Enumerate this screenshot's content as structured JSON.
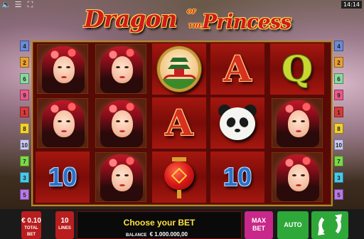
{
  "top_bar": {
    "icons": [
      "sound-icon",
      "menu-icon",
      "fullscreen-icon"
    ],
    "clock": "14:14"
  },
  "logo": {
    "main_part1": "Dragon",
    "small_of": "OF",
    "small_the": "THE",
    "main_part2": "Princess"
  },
  "reels": {
    "columns": [
      [
        "princess",
        "princess",
        "princess"
      ],
      [
        "princess",
        "princess",
        "princess"
      ],
      [
        "pagoda",
        "A",
        "lantern"
      ],
      [
        "A",
        "panda",
        "10"
      ],
      [
        "Q",
        "princess",
        "princess"
      ]
    ],
    "top_left_princess_symbols": [
      "princess",
      "princess"
    ],
    "bottom_left_symbol": "10",
    "bottom_second_symbol": "princess"
  },
  "symbols": {
    "A": "A",
    "Q": "Q",
    "ten": "10"
  },
  "line_numbers": {
    "left": [
      "4",
      "2",
      "6",
      "9",
      "1",
      "8",
      "10",
      "7",
      "3",
      "5"
    ],
    "right": [
      "4",
      "2",
      "6",
      "9",
      "1",
      "8",
      "10",
      "7",
      "3",
      "5"
    ]
  },
  "line_colors": [
    "#6a8ad8",
    "#e8a030",
    "#8ad8a0",
    "#e85a8a",
    "#d83a3a",
    "#f0d030",
    "#c8c8f0",
    "#7ad848",
    "#48c8e8",
    "#b878e8"
  ],
  "bottom": {
    "total_bet_value": "€ 0.10",
    "total_bet_label": "TOTAL BET",
    "lines_value": "10",
    "lines_label": "LINES",
    "message": "Choose your BET",
    "balance_label": "BALANCE",
    "balance_value": "€ 1.000.000,00",
    "max_bet_line1": "MAX",
    "max_bet_line2": "BET",
    "auto_label": "AUTO"
  },
  "colors": {
    "bet_button": "#b81e1e",
    "max_bet_button": "#c8288a",
    "auto_button": "#2fa83a",
    "spin_button": "#2fa83a",
    "message_text": "#ffe33a"
  }
}
